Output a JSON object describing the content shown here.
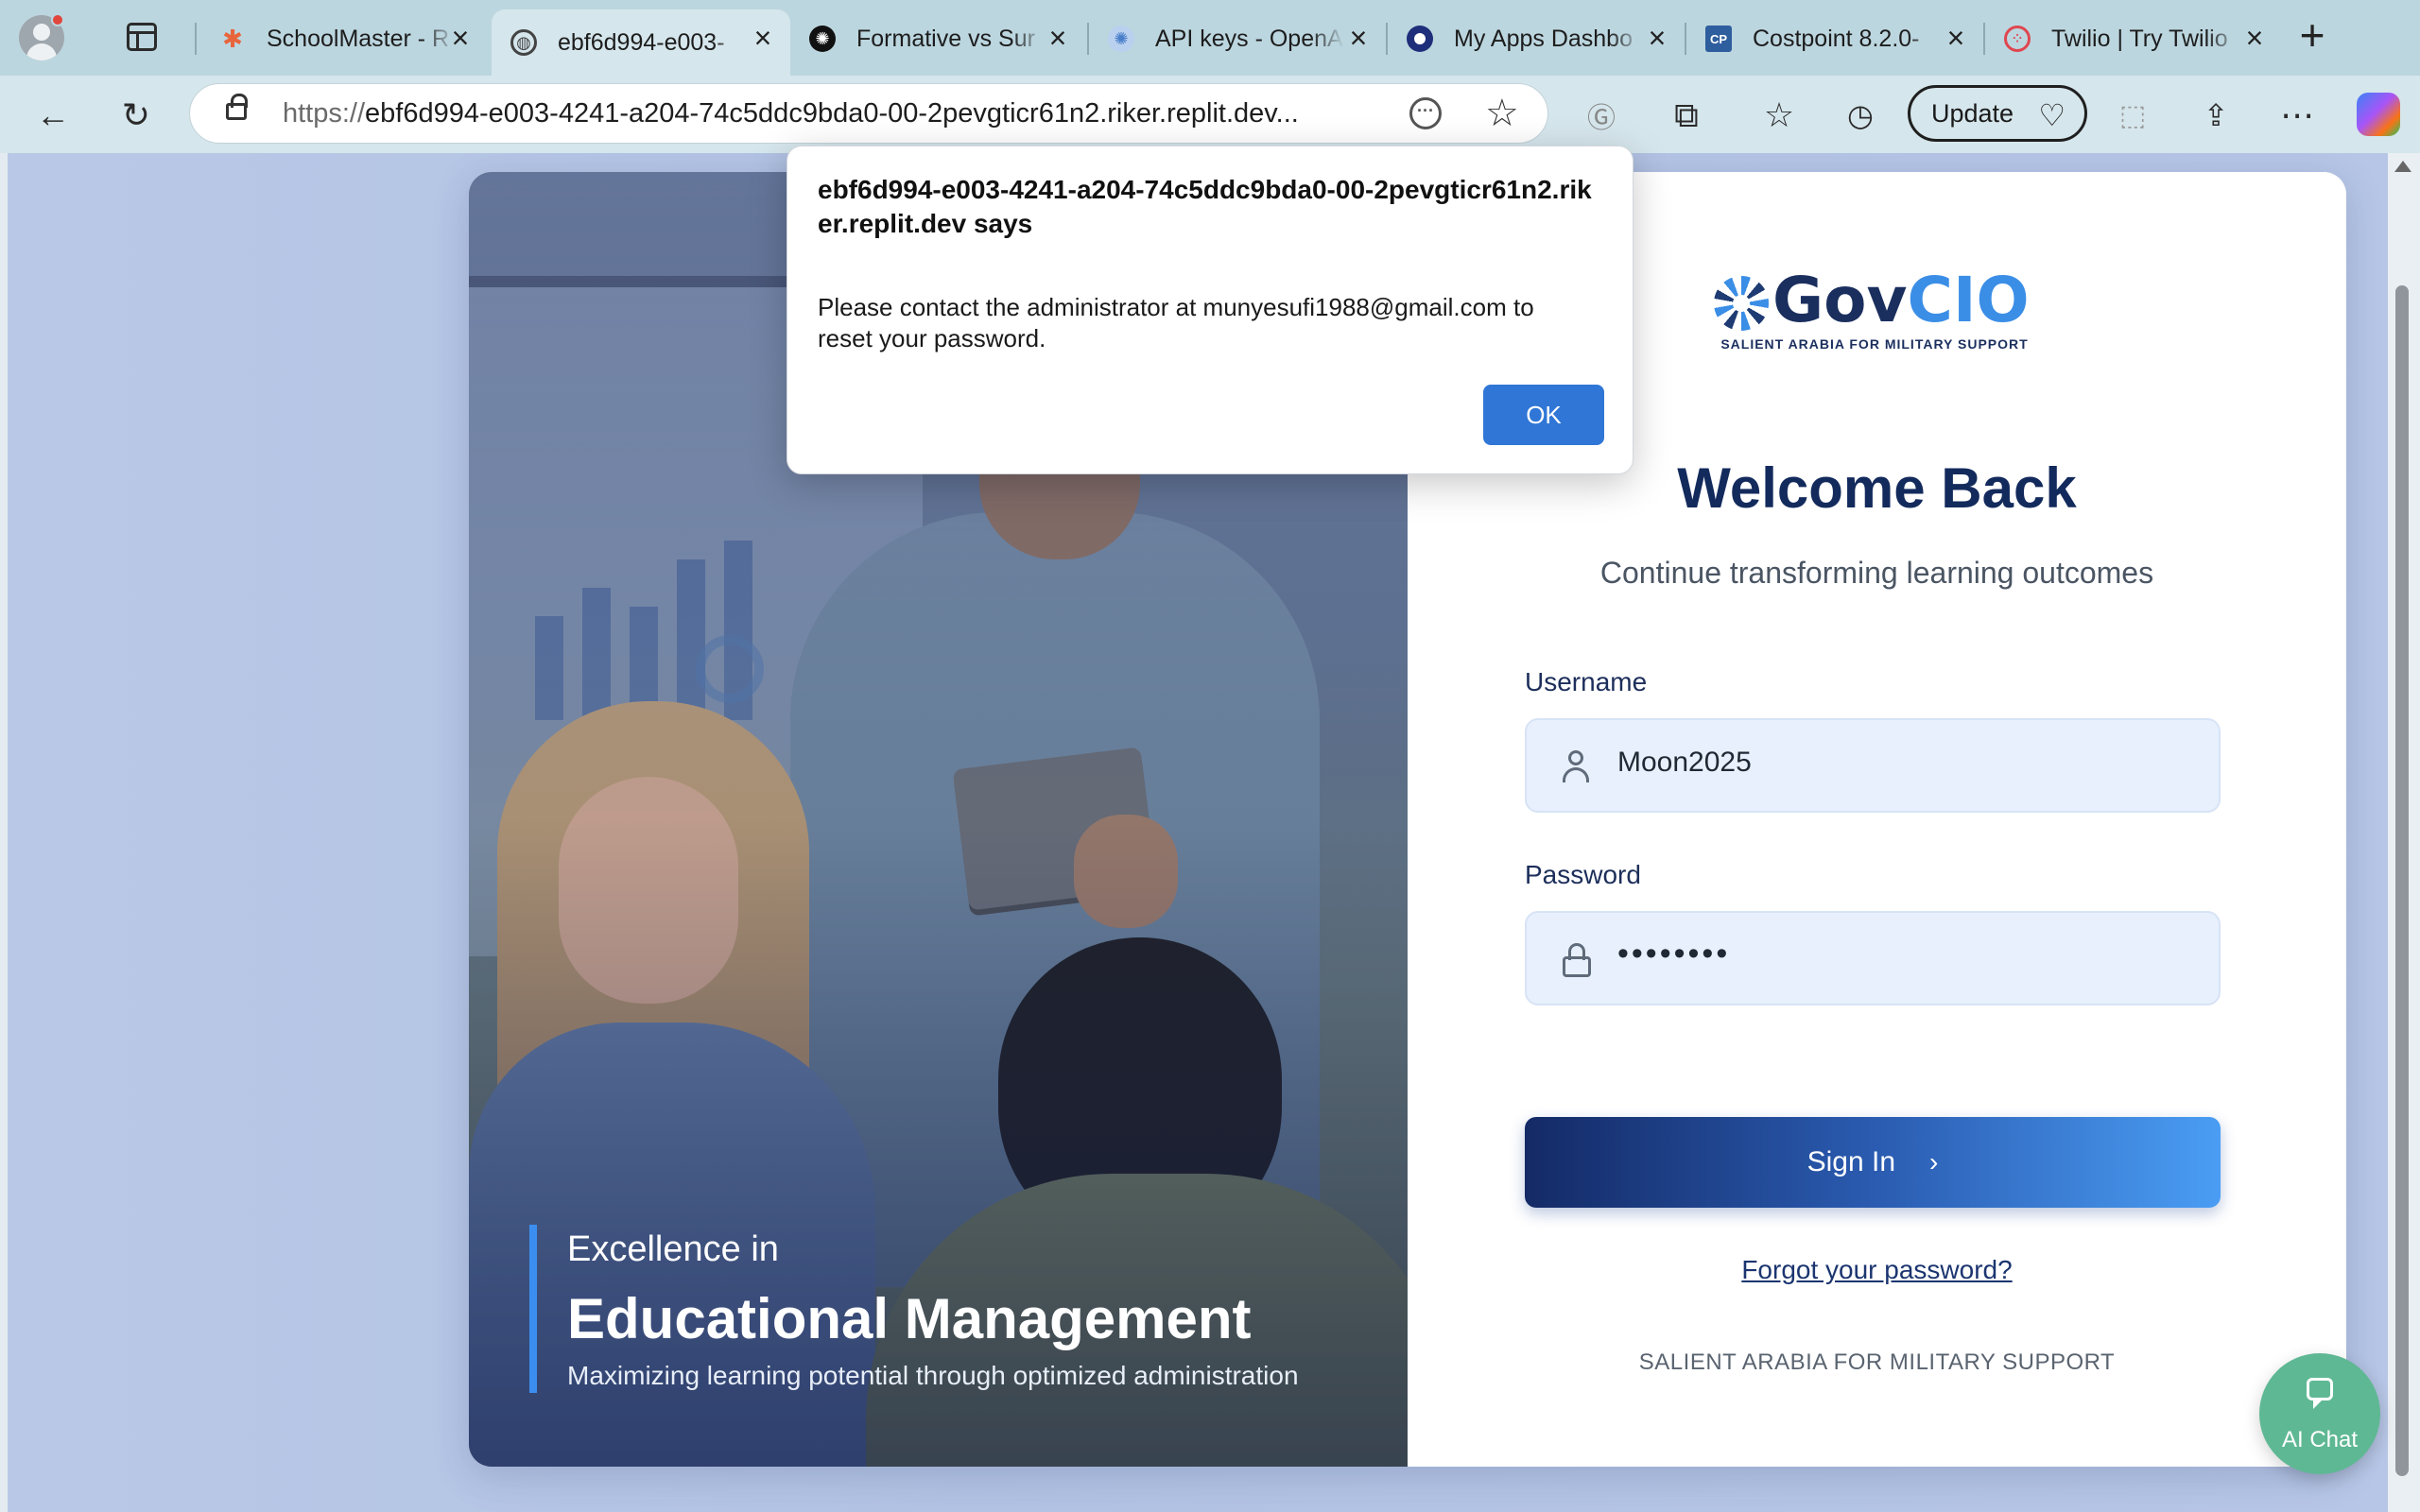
{
  "browser": {
    "tabs": [
      {
        "title": "SchoolMaster - R",
        "favicon": "schoolmaster-favicon",
        "color": "#e8643b"
      },
      {
        "title": "ebf6d994-e003-",
        "favicon": "globe-icon",
        "color": "#444444",
        "active": true
      },
      {
        "title": "Formative vs Sur",
        "favicon": "chatgpt-favicon",
        "color": "#111111"
      },
      {
        "title": "API keys - OpenA",
        "favicon": "openai-favicon",
        "color": "#6ea0e0"
      },
      {
        "title": "My Apps Dashbo",
        "favicon": "okta-favicon",
        "color": "#1f2e7a"
      },
      {
        "title": "Costpoint 8.2.0-",
        "favicon": "costpoint-favicon",
        "color": "#2f5e9e",
        "short": "CP"
      },
      {
        "title": "Twilio | Try Twilio",
        "favicon": "twilio-favicon",
        "color": "#e0464f"
      }
    ],
    "url_scheme": "https://",
    "url_rest": "ebf6d994-e003-4241-a204-74c5ddc9bda0-00-2pevgticr61n2.riker.replit.dev...",
    "update_label": "Update"
  },
  "alert": {
    "origin": "ebf6d994-e003-4241-a204-74c5ddc9bda0-00-2pevgticr61n2.riker.replit.dev says",
    "message": "Please contact the administrator at munyesufi1988@gmail.com to reset your password.",
    "ok_label": "OK"
  },
  "hero": {
    "kicker": "Excellence in",
    "title": "Educational Management",
    "subtitle": "Maximizing learning potential through optimized administration"
  },
  "login": {
    "logo_gov": "Gov",
    "logo_cio": "CIO",
    "logo_tagline": "SALIENT ARABIA FOR MILITARY SUPPORT",
    "heading": "Welcome Back",
    "tagline": "Continue transforming learning outcomes",
    "username_label": "Username",
    "username_value": "Moon2025",
    "password_label": "Password",
    "password_mask": "••••••••",
    "signin_label": "Sign In",
    "forgot_label": "Forgot your password?",
    "footer_org": "SALIENT ARABIA FOR MILITARY SUPPORT"
  },
  "ai_chat": {
    "label": "AI Chat"
  }
}
